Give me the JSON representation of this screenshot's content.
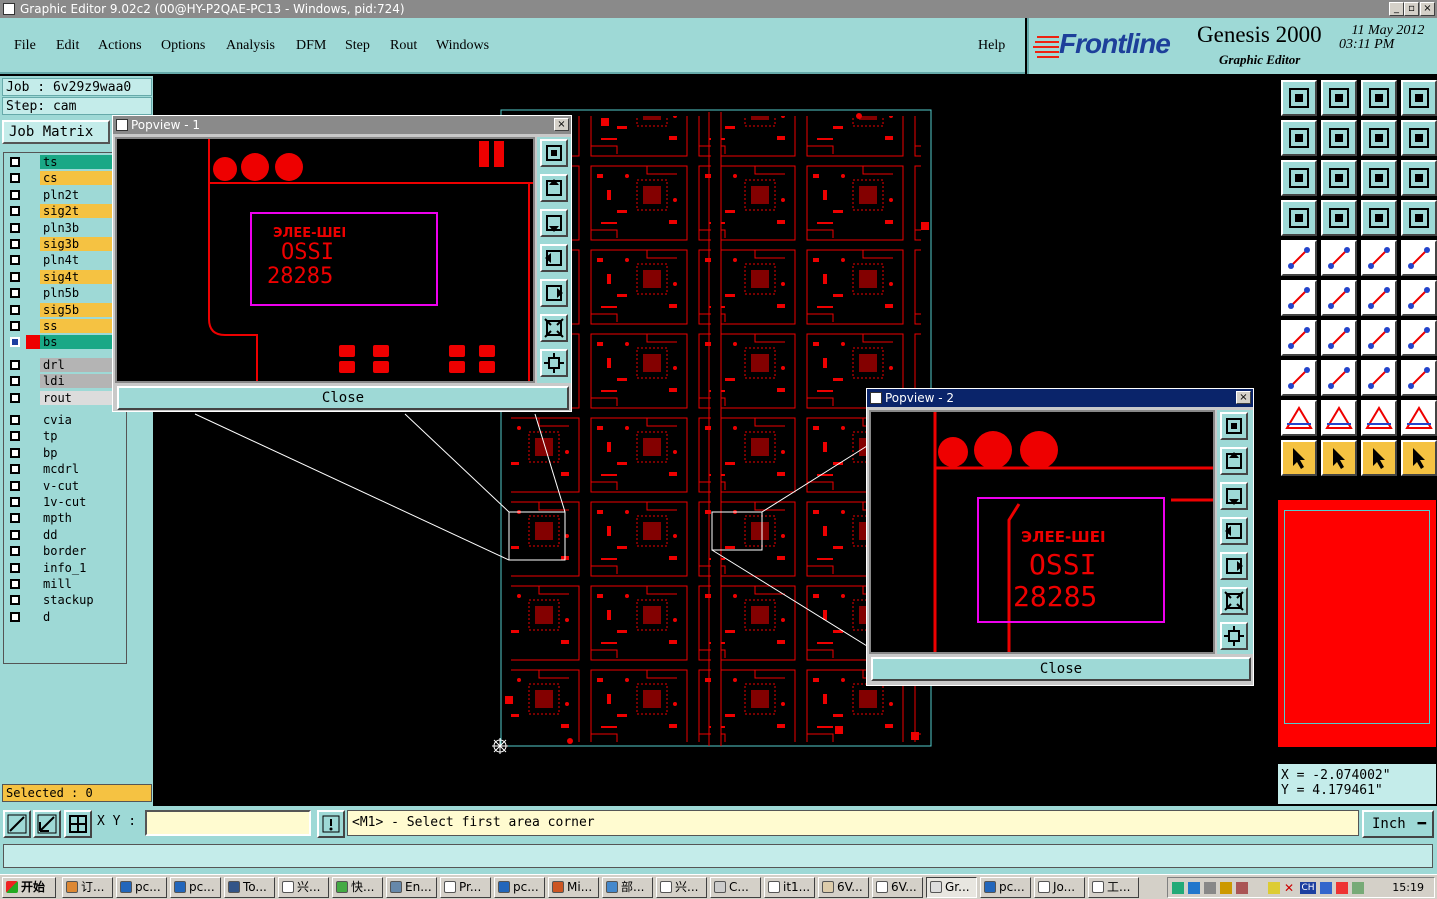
{
  "window": {
    "title": "Graphic Editor 9.02c2 (00@HY-P2QAE-PC13 - Windows, pid:724)"
  },
  "menu": [
    "File",
    "Edit",
    "Actions",
    "Options",
    "Analysis",
    "DFM",
    "Step",
    "Rout",
    "Windows"
  ],
  "help_label": "Help",
  "brand": {
    "logo": "Frontline",
    "product": "Genesis 2000",
    "subtitle": "Graphic Editor",
    "date": "11 May 2012",
    "time": "03:11 PM"
  },
  "job": {
    "job_line": "Job : 6v29z9waa0",
    "step_line": "Step: cam",
    "matrix_label": "Job Matrix"
  },
  "layers": [
    {
      "name": "ts",
      "color": "#1aa886"
    },
    {
      "name": "cs",
      "color": "#f5c242"
    },
    {
      "name": "pln2t",
      "color": "#9ed9d6"
    },
    {
      "name": "sig2t",
      "color": "#f5c242"
    },
    {
      "name": "pln3b",
      "color": "#9ed9d6"
    },
    {
      "name": "sig3b",
      "color": "#f5c242"
    },
    {
      "name": "pln4t",
      "color": "#9ed9d6"
    },
    {
      "name": "sig4t",
      "color": "#f5c242"
    },
    {
      "name": "pln5b",
      "color": "#9ed9d6"
    },
    {
      "name": "sig5b",
      "color": "#f5c242"
    },
    {
      "name": "ss",
      "color": "#f5c242"
    },
    {
      "name": "bs",
      "color": "#1aa886"
    },
    {
      "name": "drl",
      "color": "#b4b4b4"
    },
    {
      "name": "ldi",
      "color": "#b4b4b4"
    },
    {
      "name": "rout",
      "color": "#dcdcdc"
    },
    {
      "name": "cvia",
      "color": "#9ed9d6"
    },
    {
      "name": "tp",
      "color": "#9ed9d6"
    },
    {
      "name": "bp",
      "color": "#9ed9d6"
    },
    {
      "name": "mcdrl",
      "color": "#9ed9d6"
    },
    {
      "name": "v-cut",
      "color": "#9ed9d6"
    },
    {
      "name": "1v-cut",
      "color": "#9ed9d6"
    },
    {
      "name": "mpth",
      "color": "#9ed9d6"
    },
    {
      "name": "dd",
      "color": "#9ed9d6"
    },
    {
      "name": "border",
      "color": "#9ed9d6"
    },
    {
      "name": "info_1",
      "color": "#9ed9d6"
    },
    {
      "name": "mill",
      "color": "#9ed9d6"
    },
    {
      "name": "stackup",
      "color": "#9ed9d6"
    },
    {
      "name": "d",
      "color": "#9ed9d6"
    }
  ],
  "selected_label": "Selected : 0",
  "popview1": {
    "title": "Popview - 1",
    "close_label": "Close",
    "text_line1": "ЭЛЕЕ-ШЕІ",
    "text_line2": "OSSI",
    "text_line3": "28285"
  },
  "popview2": {
    "title": "Popview - 2",
    "close_label": "Close",
    "text_line1": "ЭЛЕЕ-ШЕІ",
    "text_line2": "OSSI",
    "text_line3": "28285"
  },
  "coords": {
    "x": "X = -2.074002\"",
    "y": "Y = 4.179461\""
  },
  "bottom": {
    "xy_label": "X Y :",
    "xy_value": "",
    "prompt": "<M1> - Select first area corner",
    "unit": "Inch"
  },
  "taskbar": {
    "start": "开始",
    "tasks": [
      "订...",
      "pc...",
      "pc...",
      "To...",
      "兴...",
      "快...",
      "En...",
      "Pr...",
      "pc...",
      "Mi...",
      "部...",
      "兴...",
      "C...",
      "it1...",
      "6V...",
      "6V...",
      "Gr...",
      "pc...",
      "Jo...",
      "工..."
    ],
    "clock": "15:19",
    "tray": [
      "CH"
    ]
  }
}
